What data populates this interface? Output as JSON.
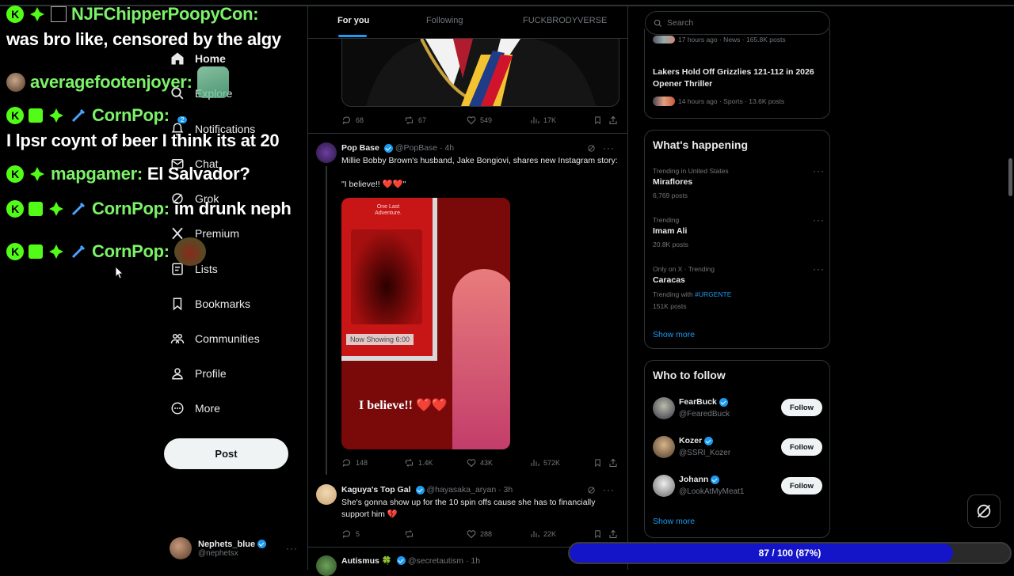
{
  "nav": {
    "items": [
      {
        "label": "Home",
        "icon": "home-icon"
      },
      {
        "label": "Explore",
        "icon": "search-icon"
      },
      {
        "label": "Notifications",
        "icon": "bell-icon",
        "badge": "2"
      },
      {
        "label": "Chat",
        "icon": "mail-icon"
      },
      {
        "label": "Grok",
        "icon": "grok-icon"
      },
      {
        "label": "Premium",
        "icon": "x-logo-icon"
      },
      {
        "label": "Lists",
        "icon": "list-icon"
      },
      {
        "label": "Bookmarks",
        "icon": "bookmark-icon"
      },
      {
        "label": "Communities",
        "icon": "people-icon"
      },
      {
        "label": "Profile",
        "icon": "person-icon"
      },
      {
        "label": "More",
        "icon": "more-circle-icon"
      }
    ],
    "post_label": "Post",
    "account": {
      "name": "Nephets_blue",
      "handle": "@nephetsx",
      "more": "···"
    }
  },
  "chat": [
    {
      "user": "NJFChipperPoopyCon:",
      "message": ""
    },
    {
      "user": "",
      "message": "was bro like, censored by the algy"
    },
    {
      "user": "averagefootenjoyer:",
      "message": ""
    },
    {
      "user": "CornPop:",
      "message": ""
    },
    {
      "user": "",
      "message": "I lpsr coynt of beer I think its at 20"
    },
    {
      "user": "mapgamer:",
      "message": "El Salvador?"
    },
    {
      "user": "CornPop:",
      "message": "im drunk neph"
    },
    {
      "user": "CornPop:",
      "message": ""
    }
  ],
  "tabs": {
    "for_you": "For you",
    "following": "Following",
    "custom": "FUCKBRODYVERSE"
  },
  "tweets": [
    {
      "actions": {
        "replies": "68",
        "reposts": "67",
        "likes": "549",
        "views": "17K"
      }
    },
    {
      "name": "Pop Base",
      "handle": "@PopBase · 4h",
      "text": "Millie Bobby Brown's husband, Jake Bongiovi, shares new Instagram story:",
      "text2": "\"I believe!! ❤️❤️\"",
      "media": {
        "poster_text": "One Last Adventure.",
        "showing": "Now Showing 6:00",
        "caption": "I believe!! ❤️❤️"
      },
      "actions": {
        "replies": "148",
        "reposts": "1.4K",
        "likes": "43K",
        "views": "572K"
      }
    },
    {
      "name": "Kaguya's Top Gal",
      "handle": "@hayasaka_aryan · 3h",
      "text": "She's gonna show up for the 10 spin offs cause she has to financially support him 💔",
      "actions": {
        "replies": "5",
        "reposts": "",
        "likes": "288",
        "views": "22K"
      }
    },
    {
      "name": "Autismus 🍀",
      "handle": "@secretautism · 1h"
    }
  ],
  "search": {
    "placeholder": "Search"
  },
  "top_trends": [
    {
      "meta": "17 hours ago · News · 165.8K posts"
    },
    {
      "title": "Lakers Hold Off Grizzlies 121-112 in 2026 Opener Thriller",
      "meta": "14 hours ago · Sports · 13.6K posts"
    }
  ],
  "happening": {
    "title": "What's happening",
    "trends": [
      {
        "category": "Trending in United States",
        "name": "Miraflores",
        "posts": "6,769 posts"
      },
      {
        "category": "Trending",
        "name": "Imam Ali",
        "posts": "20.8K posts"
      },
      {
        "category": "Only on X · Trending",
        "name": "Caracas",
        "with_label": "Trending with",
        "with_tag": "#URGENTE",
        "posts": "151K posts"
      }
    ],
    "show_more": "Show more"
  },
  "who_to_follow": {
    "title": "Who to follow",
    "people": [
      {
        "name": "FearBuck",
        "handle": "@FearedBuck",
        "button": "Follow"
      },
      {
        "name": "Kozer",
        "handle": "@SSRI_Kozer",
        "button": "Follow"
      },
      {
        "name": "Johann",
        "handle": "@LookAtMyMeat1",
        "button": "Follow"
      }
    ],
    "show_more": "Show more"
  },
  "progress": {
    "label": "87 / 100 (87%)",
    "value": 0.87
  },
  "colors": {
    "accent": "#1d9bf0",
    "chat_user": "#7cf268",
    "progress_fill": "#1414c8"
  }
}
